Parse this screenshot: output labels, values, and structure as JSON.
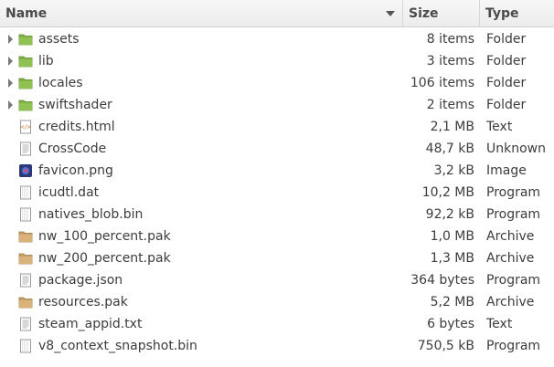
{
  "columns": {
    "name": "Name",
    "size": "Size",
    "type": "Type"
  },
  "files": [
    {
      "name": "assets",
      "size": "8 items",
      "type": "Folder",
      "icon": "folder-green-icon",
      "expandable": true
    },
    {
      "name": "lib",
      "size": "3 items",
      "type": "Folder",
      "icon": "folder-green-icon",
      "expandable": true
    },
    {
      "name": "locales",
      "size": "106 items",
      "type": "Folder",
      "icon": "folder-green-icon",
      "expandable": true
    },
    {
      "name": "swiftshader",
      "size": "2 items",
      "type": "Folder",
      "icon": "folder-green-icon",
      "expandable": true
    },
    {
      "name": "credits.html",
      "size": "2,1 MB",
      "type": "Text",
      "icon": "html-file-icon",
      "expandable": false
    },
    {
      "name": "CrossCode",
      "size": "48,7 kB",
      "type": "Unknown",
      "icon": "text-file-icon",
      "expandable": false
    },
    {
      "name": "favicon.png",
      "size": "3,2 kB",
      "type": "Image",
      "icon": "image-file-icon",
      "expandable": false
    },
    {
      "name": "icudtl.dat",
      "size": "10,2 MB",
      "type": "Program",
      "icon": "binary-file-icon",
      "expandable": false
    },
    {
      "name": "natives_blob.bin",
      "size": "92,2 kB",
      "type": "Program",
      "icon": "binary-file-icon",
      "expandable": false
    },
    {
      "name": "nw_100_percent.pak",
      "size": "1,0 MB",
      "type": "Archive",
      "icon": "archive-file-icon",
      "expandable": false
    },
    {
      "name": "nw_200_percent.pak",
      "size": "1,3 MB",
      "type": "Archive",
      "icon": "archive-file-icon",
      "expandable": false
    },
    {
      "name": "package.json",
      "size": "364 bytes",
      "type": "Program",
      "icon": "text-file-icon",
      "expandable": false
    },
    {
      "name": "resources.pak",
      "size": "5,2 MB",
      "type": "Archive",
      "icon": "archive-file-icon",
      "expandable": false
    },
    {
      "name": "steam_appid.txt",
      "size": "6 bytes",
      "type": "Text",
      "icon": "text-file-icon",
      "expandable": false
    },
    {
      "name": "v8_context_snapshot.bin",
      "size": "750,5 kB",
      "type": "Program",
      "icon": "binary-file-icon",
      "expandable": false
    }
  ],
  "colors": {
    "folder": "#7eb245",
    "archive": "#c8a066"
  }
}
